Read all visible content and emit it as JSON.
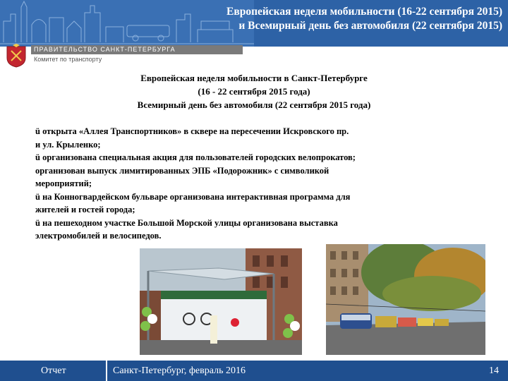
{
  "header": {
    "title_line1": "Европейская неделя мобильности (16-22 сентября 2015)",
    "title_line2": "и Всемирный день без автомобиля (22 сентября 2015)"
  },
  "org": {
    "name": "ПРАВИТЕЛЬСТВО САНКТ-ПЕТЕРБУРГА",
    "sub": "Комитет по транспорту"
  },
  "intro": {
    "line1": "Европейская неделя мобильности в Санкт-Петербурге",
    "line2": "(16 - 22 сентября 2015 года)",
    "line3": "Всемирный день без автомобиля  (22 сентября 2015 года)"
  },
  "bullets": [
    "ü открыта «Аллея Транспортников» в сквере на пересечении Искровского пр.",
    "и ул. Крыленко;",
    "ü организована специальная акция для пользователей городских велопрокатов;",
    "организован выпуск лимитированных ЭПБ «Подорожник» с символикой",
    "мероприятий;",
    "ü на Конногвардейском бульваре организована интерактивная программа для",
    "жителей и гостей города;",
    "ü на пешеходном участке Большой Морской улицы организована выставка",
    "электромобилей  и велосипедов."
  ],
  "footer": {
    "report": "Отчет",
    "city_date": "Санкт-Петербург, февраль 2016",
    "page": "14"
  },
  "colors": {
    "header_blue": "#2d62a6",
    "footer_blue": "#1f4f8f"
  }
}
